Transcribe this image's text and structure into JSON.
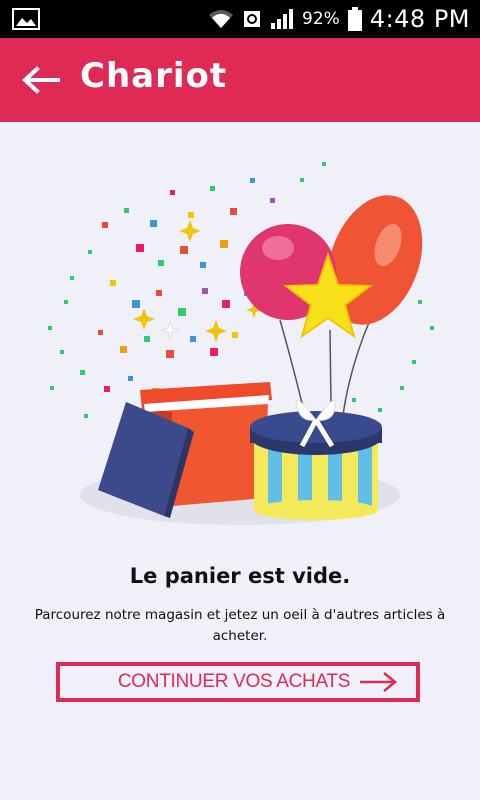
{
  "status_bar": {
    "battery_percent": "92%",
    "time": "4:48 PM",
    "icons": [
      "gallery-icon",
      "wifi-icon",
      "vpn-globe-icon",
      "signal-icon",
      "battery-icon"
    ]
  },
  "app_bar": {
    "title": "Chariot",
    "back_icon": "arrow-left-icon",
    "background": "#e02a56"
  },
  "empty_cart": {
    "illustration": "gift-boxes-balloons-confetti",
    "title": "Le panier est vide.",
    "subtitle": "Parcourez notre magasin et jetez un oeil à d'autres articles à acheter.",
    "button_label": "CONTINUER VOS ACHATS",
    "button_icon": "arrow-right-icon",
    "accent": "#e02a56"
  }
}
